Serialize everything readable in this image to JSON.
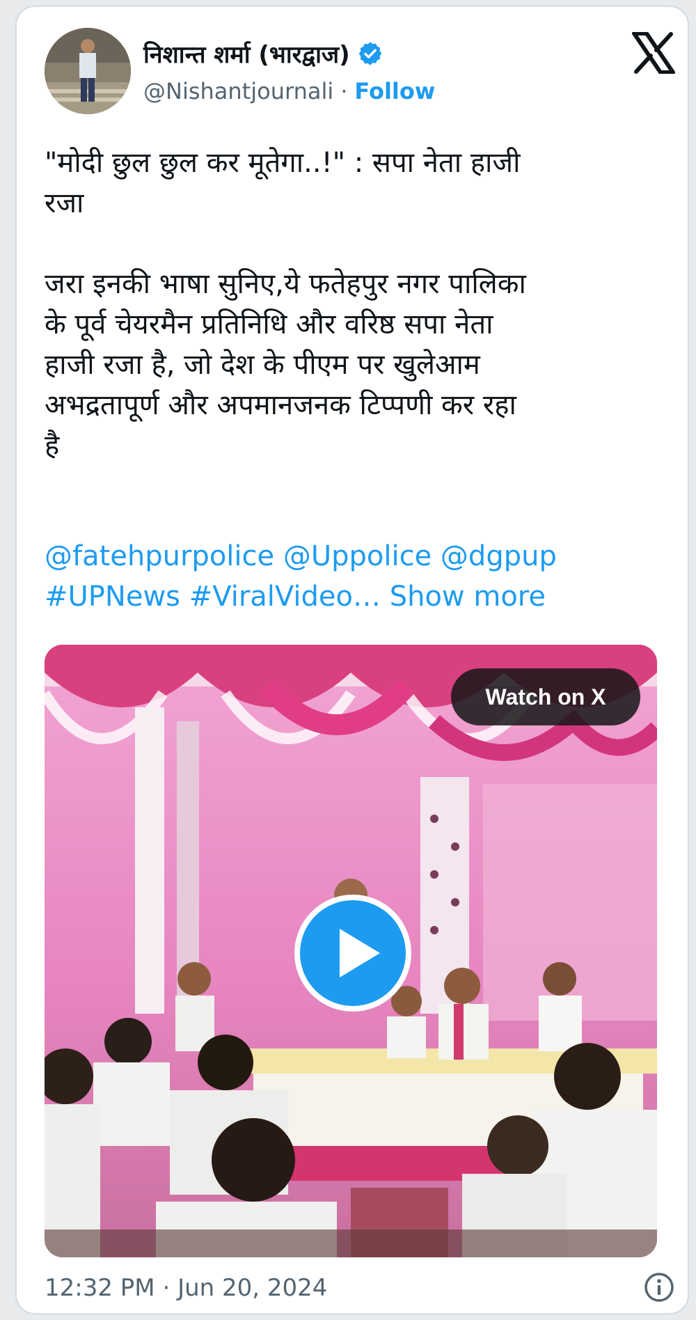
{
  "author": {
    "display_name": "निशान्त शर्मा (भारद्वाज)",
    "handle": "@Nishantjournali",
    "separator": "·",
    "follow_label": "Follow",
    "verified": true
  },
  "tweet": {
    "headline_line1": "\"मोदी छुल छुल कर मूतेगा..!\" : सपा नेता हाजी",
    "headline_line2": "रजा",
    "body_line1": "जरा इनकी भाषा सुनिए,ये फतेहपुर नगर पालिका",
    "body_line2": "के पूर्व चेयरमैन प्रतिनिधि और वरिष्ठ सपा नेता",
    "body_line3": "हाजी रजा है, जो देश के पीएम पर खुलेआम",
    "body_line4": "अभद्रतापूर्ण और अपमानजनक टिप्पणी कर रहा",
    "body_line5": "है",
    "mentions": [
      "@fatehpurpolice",
      "@Uppolice",
      "@dgpup"
    ],
    "hashtags": [
      "#UPNews",
      "#ViralVideo…"
    ],
    "show_more_label": "Show more"
  },
  "media": {
    "watch_label": "Watch on X",
    "play_icon": "play-icon"
  },
  "footer": {
    "time": "12:32 PM",
    "separator": "·",
    "date": "Jun 20, 2024",
    "info_icon": "info-icon"
  },
  "colors": {
    "accent": "#1d9bf0",
    "text": "#0f1419",
    "muted": "#536471",
    "pink": "#e389c2"
  }
}
